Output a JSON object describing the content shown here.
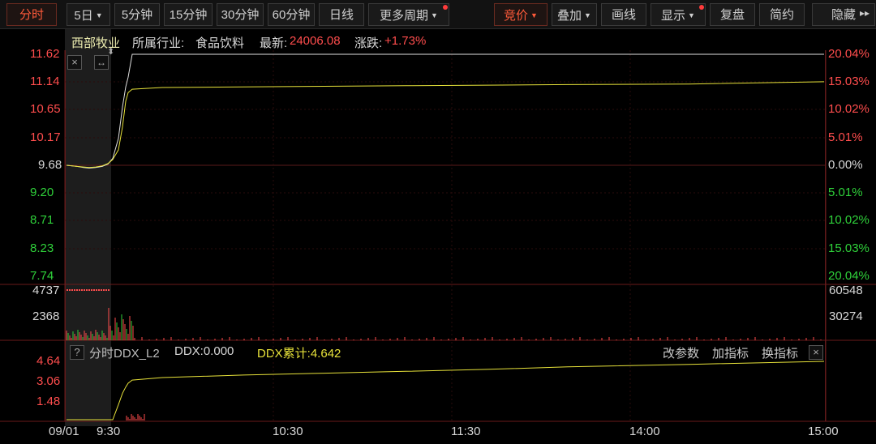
{
  "toolbar": {
    "items": [
      {
        "label": "分时",
        "active": true,
        "caret": false,
        "dot": false
      },
      {
        "label": "5日",
        "active": false,
        "caret": true,
        "dot": false
      },
      {
        "label": "5分钟",
        "active": false,
        "caret": false,
        "dot": false
      },
      {
        "label": "15分钟",
        "active": false,
        "caret": false,
        "dot": false
      },
      {
        "label": "30分钟",
        "active": false,
        "caret": false,
        "dot": false
      },
      {
        "label": "60分钟",
        "active": false,
        "caret": false,
        "dot": false
      },
      {
        "label": "日线",
        "active": false,
        "caret": false,
        "dot": false
      },
      {
        "label": "更多周期",
        "active": false,
        "caret": true,
        "dot": true
      },
      {
        "label": "竞价",
        "active": true,
        "caret": true,
        "dot": false
      },
      {
        "label": "叠加",
        "active": false,
        "caret": true,
        "dot": false
      },
      {
        "label": "画线",
        "active": false,
        "caret": false,
        "dot": false
      },
      {
        "label": "显示",
        "active": false,
        "caret": true,
        "dot": true
      },
      {
        "label": "复盘",
        "active": false,
        "caret": false,
        "dot": false
      },
      {
        "label": "简约",
        "active": false,
        "caret": false,
        "dot": false
      },
      {
        "label": "隐藏",
        "active": false,
        "caret": false,
        "dot": false
      }
    ],
    "more_arrows": "▸▸"
  },
  "info": {
    "stock_name": "西部牧业",
    "industry_label": "所属行业:",
    "industry": "食品饮料",
    "latest_label": "最新:",
    "latest": "24006.08",
    "change_label": "涨跌:",
    "change": "+1.73%"
  },
  "price_axis": {
    "left": [
      "11.62",
      "11.14",
      "10.65",
      "10.17",
      "9.68",
      "9.20",
      "8.71",
      "8.23",
      "7.74"
    ],
    "right": [
      "20.04%",
      "15.03%",
      "10.02%",
      "5.01%",
      "0.00%",
      "5.01%",
      "10.02%",
      "15.03%",
      "20.04%"
    ]
  },
  "volume_axis": {
    "left": [
      "4737",
      "2368"
    ],
    "right": [
      "60548",
      "30274"
    ]
  },
  "indicator": {
    "help": "?",
    "name": "分时DDX_L2",
    "ddx": "DDX:0.000",
    "ddx_cum": "DDX累计:4.642",
    "axis": [
      "4.64",
      "3.06",
      "1.48"
    ],
    "buttons": [
      "改参数",
      "加指标",
      "换指标"
    ],
    "close": "×"
  },
  "time_axis": {
    "date": "09/01",
    "ticks": [
      "9:30",
      "10:30",
      "11:30",
      "14:00",
      "15:00"
    ]
  },
  "colors": {
    "up": "#ff4d4d",
    "down": "#2fd13a",
    "price_line": "#e0e0e0",
    "avg_line": "#e7e23a",
    "active": "#ff5a3a"
  },
  "chart_data": {
    "type": "line",
    "series": [
      {
        "values": [
          9.68,
          9.66,
          9.64,
          9.63,
          9.64,
          9.66,
          9.7,
          9.8,
          10.15,
          10.7,
          11.05,
          11.22,
          11.62,
          11.62,
          11.62,
          11.62,
          11.62,
          11.62,
          11.62,
          11.62,
          11.62
        ]
      },
      {
        "values": [
          9.68,
          9.66,
          9.65,
          9.64,
          9.65,
          9.67,
          9.71,
          9.78,
          9.95,
          10.35,
          10.8,
          10.95,
          11.01,
          11.04,
          11.05,
          11.06,
          11.07,
          11.08,
          11.09,
          11.1,
          11.14
        ]
      },
      {
        "values": [
          0,
          0,
          0,
          0,
          0,
          0,
          0,
          0,
          1.2,
          2.1,
          2.6,
          2.9,
          3.15,
          3.35,
          3.55,
          3.7,
          3.85,
          4.0,
          4.2,
          4.4,
          4.64
        ]
      }
    ],
    "x": [
      "9:30",
      "10:30",
      "11:30",
      "14:00",
      "15:00"
    ],
    "ylim": [
      7.74,
      11.62
    ]
  }
}
